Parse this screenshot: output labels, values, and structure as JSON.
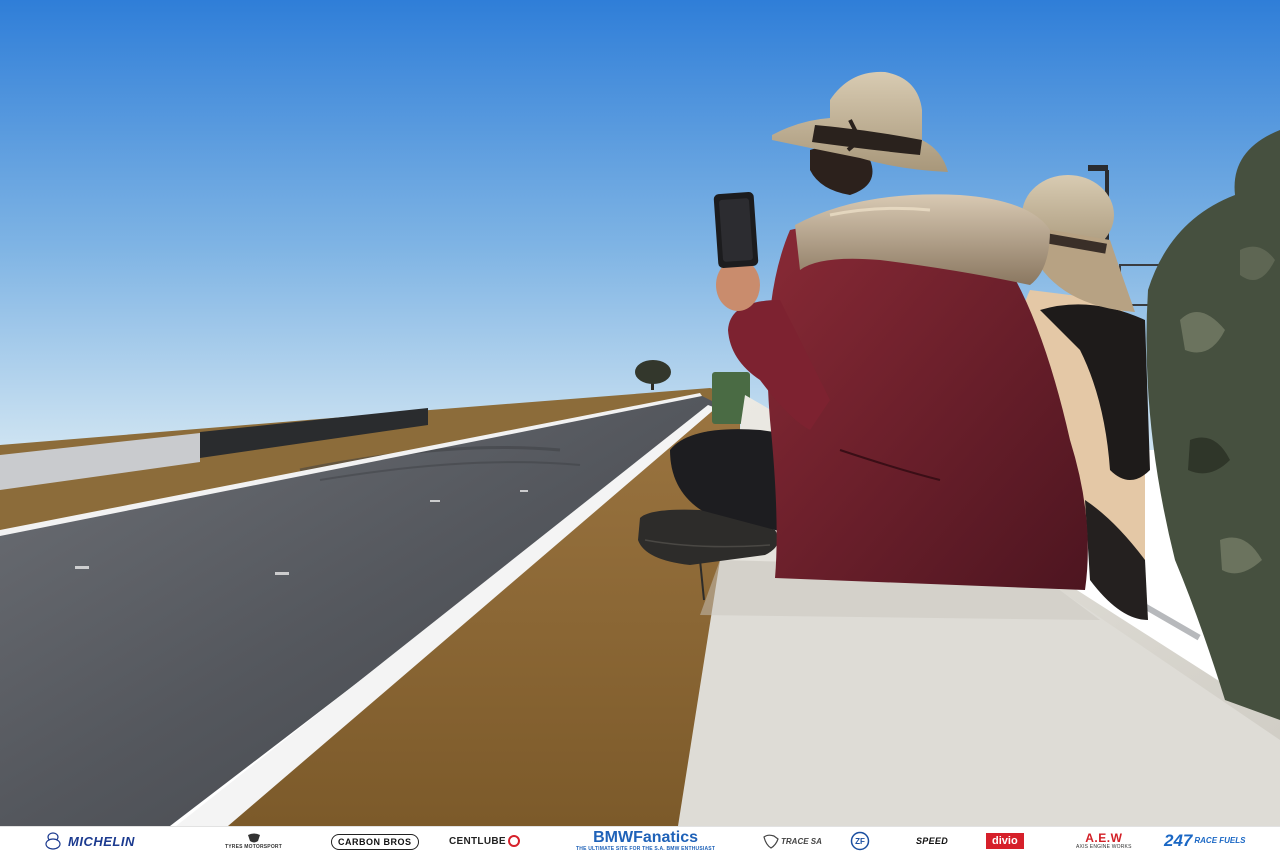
{
  "photo": {
    "colors": {
      "sky_top": "#2f7ed8",
      "sky_bottom": "#cfe4f2",
      "asphalt": "#4c4f55",
      "grass": "#8e6a34",
      "jacket": "#6a1f2a",
      "wall": "#dcdad3",
      "camo": "#46503f"
    }
  },
  "sponsors": {
    "michelin": "MICHELIN",
    "tyres": "TYRES MOTORSPORT",
    "carbon": "CARBON BROS",
    "centlube": "CENTLUBE",
    "bmw": "BMWFanatics",
    "bmw_tagline": "THE ULTIMATE SITE FOR THE S.A. BMW ENTHUSIAST",
    "trace": "TRACE SA",
    "zf": "ZF",
    "speed": "SPEED",
    "divio": "divio",
    "aew": "A.E.W",
    "aew_tagline": "AXIS ENGINE WORKS",
    "race_fuels": "247",
    "race_fuels_sub": "RACE FUELS"
  }
}
